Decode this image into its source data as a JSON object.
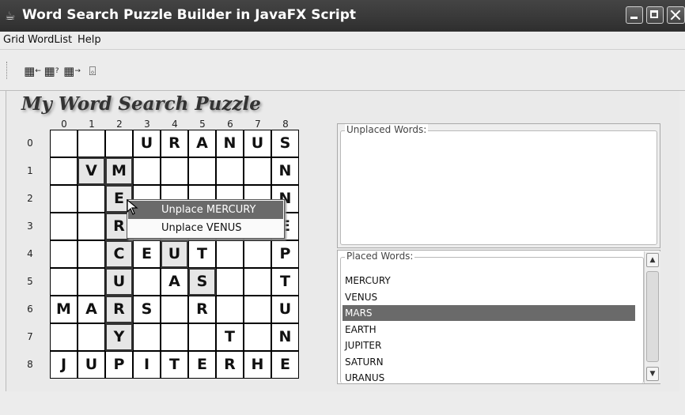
{
  "window": {
    "title": "Word Search Puzzle Builder in JavaFX Script"
  },
  "menubar": [
    "Grid",
    "WordList",
    "Help"
  ],
  "toolbar": {
    "icons": [
      "grid-left-icon",
      "grid-question-icon",
      "grid-right-icon",
      "package-add-icon"
    ]
  },
  "puzzle": {
    "title": "My Word Search Puzzle",
    "col_labels": [
      "0",
      "1",
      "2",
      "3",
      "4",
      "5",
      "6",
      "7",
      "8"
    ],
    "row_labels": [
      "0",
      "1",
      "2",
      "3",
      "4",
      "5",
      "6",
      "7",
      "8"
    ],
    "rows": [
      [
        "",
        "",
        "",
        "U",
        "R",
        "A",
        "N",
        "U",
        "S"
      ],
      [
        "",
        "V",
        "M",
        "",
        "",
        "",
        "",
        "",
        "N"
      ],
      [
        "",
        "",
        "E",
        "",
        "",
        "",
        "",
        "",
        "N"
      ],
      [
        "",
        "",
        "R",
        "",
        "",
        "",
        "",
        "",
        "E"
      ],
      [
        "",
        "",
        "C",
        "E",
        "U",
        "T",
        "",
        "",
        "P"
      ],
      [
        "",
        "",
        "U",
        "",
        "A",
        "S",
        "",
        "",
        "T"
      ],
      [
        "M",
        "A",
        "R",
        "S",
        "",
        "R",
        "",
        "",
        "U"
      ],
      [
        "",
        "",
        "Y",
        "",
        "",
        "",
        "T",
        "",
        "N"
      ],
      [
        "J",
        "U",
        "P",
        "I",
        "T",
        "E",
        "R",
        "H",
        "E"
      ]
    ],
    "highlighted_cells": [
      [
        1,
        1
      ],
      [
        1,
        2
      ],
      [
        2,
        2
      ],
      [
        3,
        2
      ],
      [
        4,
        2
      ],
      [
        5,
        2
      ],
      [
        6,
        2
      ],
      [
        7,
        2
      ],
      [
        4,
        4
      ],
      [
        5,
        5
      ]
    ]
  },
  "context_menu": {
    "items": [
      "Unplace MERCURY",
      "Unplace VENUS"
    ],
    "selected_index": 0
  },
  "unplaced_panel": {
    "label": "Unplaced Words:",
    "items": []
  },
  "placed_panel": {
    "label": "Placed Words:",
    "items": [
      "MERCURY",
      "VENUS",
      "MARS",
      "EARTH",
      "JUPITER",
      "SATURN",
      "URANUS"
    ],
    "selected_index": 2
  }
}
